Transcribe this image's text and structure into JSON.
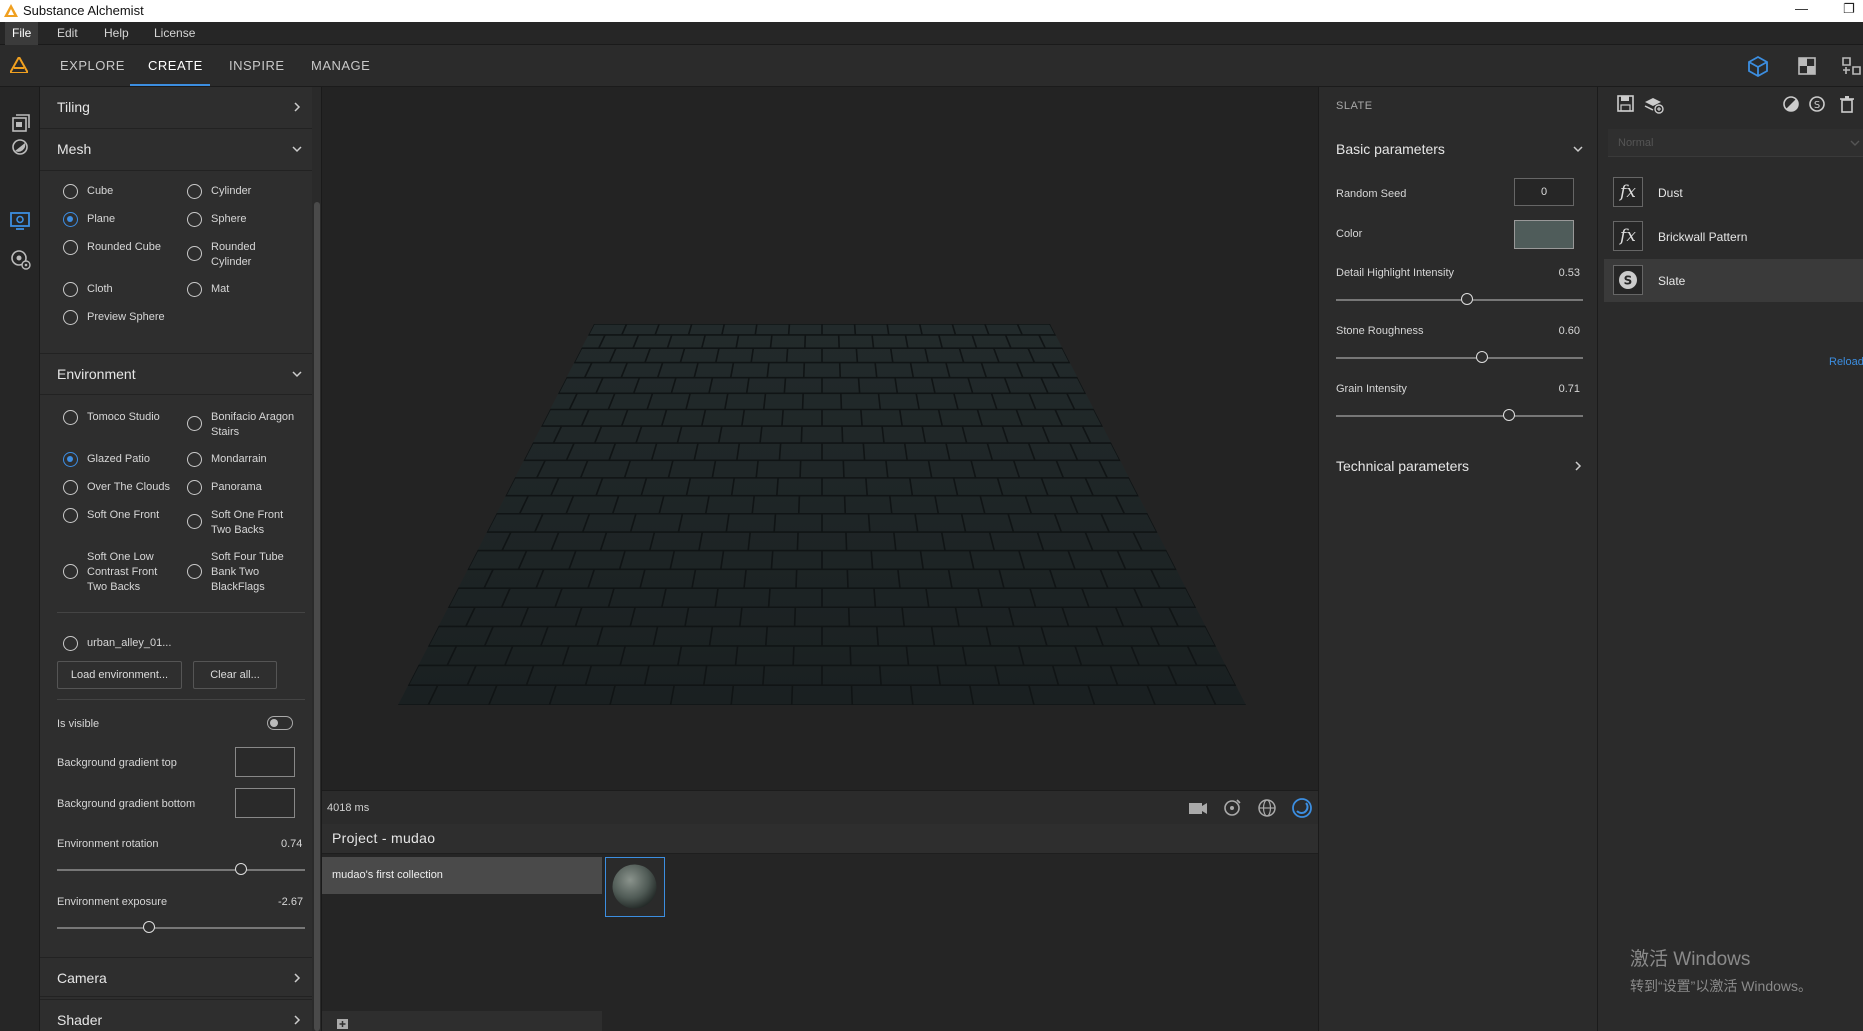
{
  "app": {
    "title": "Substance Alchemist",
    "window_controls": {
      "minimize": "—",
      "restore": "❐"
    }
  },
  "menu": {
    "items": [
      "File",
      "Edit",
      "Help",
      "License"
    ],
    "active": "File"
  },
  "nav": {
    "tabs": [
      "EXPLORE",
      "CREATE",
      "INSPIRE",
      "MANAGE"
    ],
    "active": "CREATE"
  },
  "top_icons": [
    "3d-view-icon",
    "2d-view-icon",
    "split-view-icon"
  ],
  "left_strip_icons": [
    "library-icon",
    "material-icon",
    "viewport-settings-icon",
    "settings-icon"
  ],
  "left_panel": {
    "tiling": {
      "title": "Tiling"
    },
    "mesh": {
      "title": "Mesh",
      "options": [
        {
          "label": "Cube",
          "checked": false
        },
        {
          "label": "Cylinder",
          "checked": false
        },
        {
          "label": "Plane",
          "checked": true
        },
        {
          "label": "Sphere",
          "checked": false
        },
        {
          "label": "Rounded Cube",
          "checked": false
        },
        {
          "label": "Rounded Cylinder",
          "checked": false
        },
        {
          "label": "Cloth",
          "checked": false
        },
        {
          "label": "Mat",
          "checked": false
        },
        {
          "label": "Preview Sphere",
          "checked": false
        }
      ]
    },
    "environment": {
      "title": "Environment",
      "options": [
        {
          "label": "Tomoco Studio",
          "checked": false
        },
        {
          "label": "Bonifacio Aragon Stairs",
          "checked": false
        },
        {
          "label": "Glazed Patio",
          "checked": true
        },
        {
          "label": "Mondarrain",
          "checked": false
        },
        {
          "label": "Over The Clouds",
          "checked": false
        },
        {
          "label": "Panorama",
          "checked": false
        },
        {
          "label": "Soft One Front",
          "checked": false
        },
        {
          "label": "Soft One Front Two Backs",
          "checked": false
        },
        {
          "label": "Soft One Low Contrast Front Two Backs",
          "checked": false
        },
        {
          "label": "Soft Four Tube Bank Two BlackFlags",
          "checked": false
        },
        {
          "label": "urban_alley_01...",
          "checked": false
        }
      ],
      "load_button": "Load environment...",
      "clear_button": "Clear all...",
      "is_visible_label": "Is visible",
      "is_visible": false,
      "bg_top_label": "Background gradient top",
      "bg_bottom_label": "Background gradient bottom",
      "rotation": {
        "label": "Environment rotation",
        "value": "0.74",
        "fraction": 0.74
      },
      "exposure": {
        "label": "Environment exposure",
        "value": "-2.67",
        "fraction": 0.37
      }
    },
    "camera": {
      "title": "Camera"
    },
    "shader": {
      "title": "Shader"
    }
  },
  "viewport": {
    "render_time": "4018 ms",
    "icons": [
      "camera-icon",
      "rotate-light-icon",
      "globe-icon",
      "material-ball-icon"
    ]
  },
  "project": {
    "title": "Project - mudao",
    "collection": "mudao's first collection"
  },
  "params": {
    "section": "SLATE",
    "basic_title": "Basic parameters",
    "random_seed": {
      "label": "Random Seed",
      "value": "0"
    },
    "color": {
      "label": "Color",
      "value": "#4f5c5a"
    },
    "sliders": [
      {
        "label": "Detail Highlight Intensity",
        "value": "0.53",
        "fraction": 0.53
      },
      {
        "label": "Stone Roughness",
        "value": "0.60",
        "fraction": 0.59
      },
      {
        "label": "Grain Intensity",
        "value": "0.71",
        "fraction": 0.7
      }
    ],
    "technical_title": "Technical parameters"
  },
  "layers": {
    "blend_mode": "Normal",
    "items": [
      {
        "name": "Dust",
        "icon": "fx-icon",
        "active": false
      },
      {
        "name": "Brickwall Pattern",
        "icon": "fx-icon",
        "active": false
      },
      {
        "name": "Slate",
        "icon": "substance-icon",
        "active": true
      }
    ],
    "reload_label": "Reload"
  },
  "watermark": {
    "line1": "激活 Windows",
    "line2": "转到“设置”以激活 Windows。"
  },
  "colors": {
    "accent": "#3c8ee0",
    "panel": "#2e2e2e",
    "logo": "#f0a020"
  }
}
